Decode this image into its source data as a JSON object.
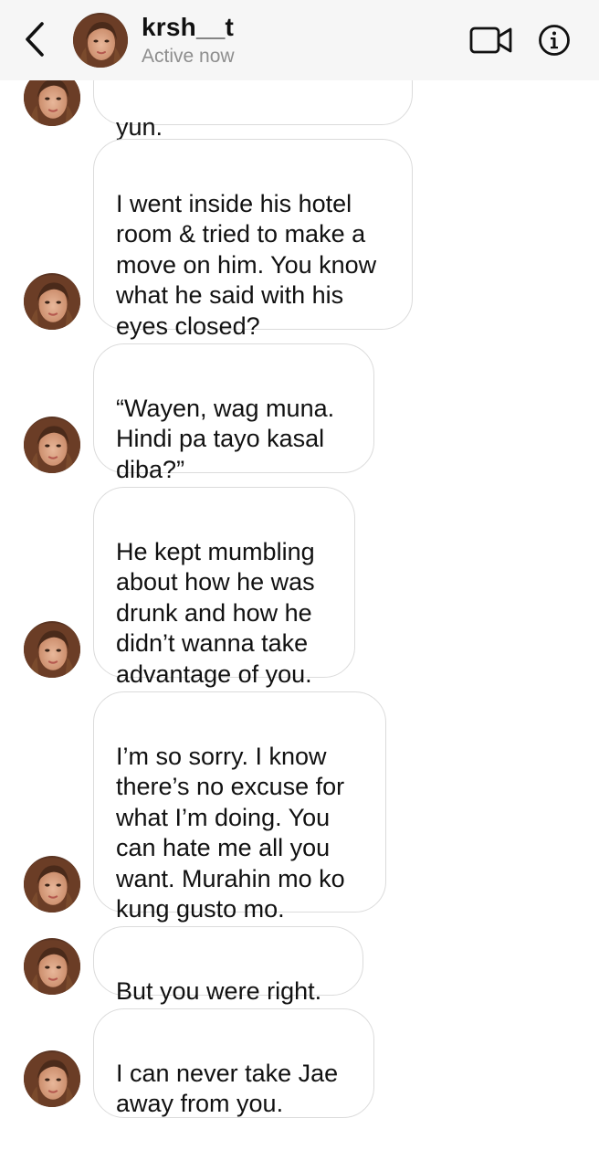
{
  "header": {
    "username": "krsh__t",
    "status": "Active now",
    "icons": {
      "back": "chevron-left-icon",
      "video": "video-camera-icon",
      "info": "info-icon"
    }
  },
  "messages": [
    {
      "text": "yun."
    },
    {
      "text": "I went inside his hotel\nroom & tried to make a\nmove on him. You know\nwhat he said with his\neyes closed?"
    },
    {
      "text": "“Wayen, wag muna.\nHindi pa tayo kasal\ndiba?”"
    },
    {
      "text": "He kept mumbling\nabout how he was\ndrunk and how he\ndidn’t wanna take\nadvantage of you."
    },
    {
      "text": "I’m so sorry. I know\nthere’s no excuse for\nwhat I’m doing. You\ncan hate me all you\nwant. Murahin mo ko\nkung gusto mo."
    },
    {
      "text": "But you were right."
    },
    {
      "text": "I can never take Jae\naway from you."
    }
  ],
  "colors": {
    "header_bg": "#f6f6f6",
    "bubble_border": "#dbdbdb",
    "status_text": "#8e8e8e"
  }
}
